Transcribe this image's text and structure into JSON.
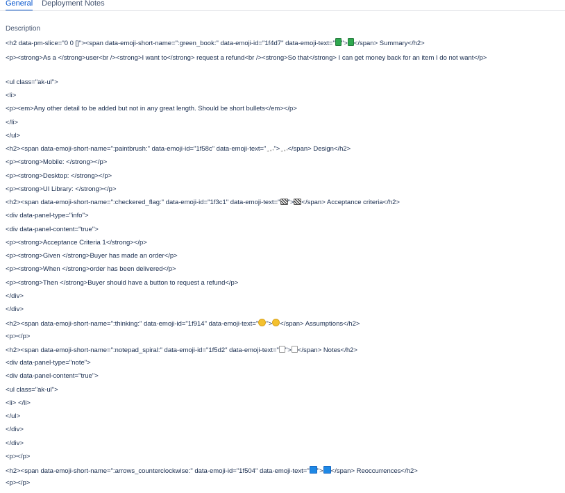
{
  "tabs": {
    "general": "General",
    "deployment_notes": "Deployment Notes"
  },
  "description": {
    "label": "Description",
    "lines": [
      {
        "a": "<h2 data-pm-slice=\"0 0 []\"><span data-emoji-short-name=\":green_book:\" data-emoji-id=\"1f4d7\" data-emoji-text=\"",
        "icon": "green-book-icon",
        "b": "\">",
        "c": "</span> Summary</h2>"
      },
      {
        "text": "<p><strong>As a </strong>user<br /><strong>I want to</strong> request a refund<br /><strong>So that</strong> I can get money back for an item I do not want</p>"
      },
      {
        "text": "<ul class=\"ak-ul\">"
      },
      {
        "text": "<li>"
      },
      {
        "text": "<p><em>Any other detail to be added but not in any great length. Should be short bullets</em></p>"
      },
      {
        "text": "</li>"
      },
      {
        "text": "</ul>"
      },
      {
        "a": "<h2><span data-emoji-short-name=\":paintbrush:\" data-emoji-id=\"1f58c\" data-emoji-text=\"",
        "icon": "paintbrush-icon",
        "b": "\">",
        "c": "</span> Design</h2>"
      },
      {
        "text": "<p><strong>Mobile: </strong></p>"
      },
      {
        "text": "<p><strong>Desktop: </strong></p>"
      },
      {
        "text": "<p><strong>UI Library: </strong></p>"
      },
      {
        "a": "<h2><span data-emoji-short-name=\":checkered_flag:\" data-emoji-id=\"1f3c1\" data-emoji-text=\"",
        "icon": "checkered-flag-icon",
        "b": "\">",
        "c": "</span> Acceptance criteria</h2>"
      },
      {
        "text": "<div data-panel-type=\"info\">"
      },
      {
        "text": "<div data-panel-content=\"true\">"
      },
      {
        "text": "<p><strong>Acceptance Criteria 1</strong></p>"
      },
      {
        "text": "<p><strong>Given </strong>Buyer has made an order</p>"
      },
      {
        "text": "<p><strong>When </strong>order has been delivered</p>"
      },
      {
        "text": "<p><strong>Then </strong>Buyer should have a button to request a refund</p>"
      },
      {
        "text": "</div>"
      },
      {
        "text": "</div>"
      },
      {
        "a": "<h2><span data-emoji-short-name=\":thinking:\" data-emoji-id=\"1f914\" data-emoji-text=\"",
        "icon": "thinking-face-icon",
        "b": "\">",
        "c": "</span> Assumptions</h2>"
      },
      {
        "text": "<p></p>"
      },
      {
        "a": "<h2><span data-emoji-short-name=\":notepad_spiral:\" data-emoji-id=\"1f5d2\" data-emoji-text=\"",
        "icon": "notepad-icon",
        "b": "\">",
        "c": "</span> Notes</h2>"
      },
      {
        "text": "<div data-panel-type=\"note\">"
      },
      {
        "text": "<div data-panel-content=\"true\">"
      },
      {
        "text": "<ul class=\"ak-ul\">"
      },
      {
        "text": "<li> </li>"
      },
      {
        "text": "</ul>"
      },
      {
        "text": "</div>"
      },
      {
        "text": "</div>"
      },
      {
        "text": "<p></p>"
      },
      {
        "a": "<h2><span data-emoji-short-name=\":arrows_counterclockwise:\" data-emoji-id=\"1f504\" data-emoji-text=\"",
        "icon": "arrows-counterclockwise-icon",
        "b": "\">",
        "c": "</span> Reoccurrences</h2>"
      },
      {
        "text": "<p></p>"
      }
    ]
  }
}
